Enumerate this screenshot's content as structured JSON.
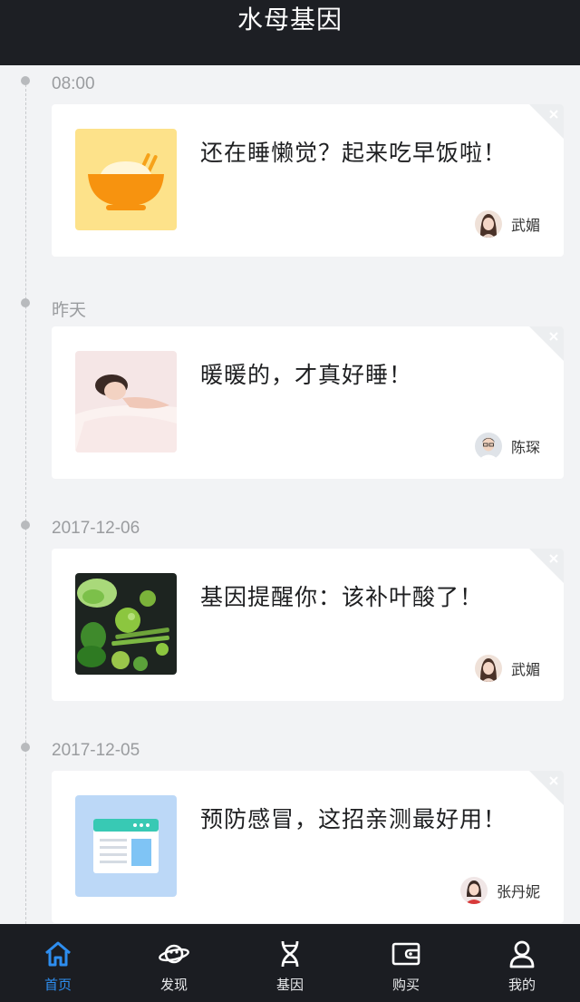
{
  "header": {
    "title": "水母基因"
  },
  "entries": [
    {
      "date": "08:00",
      "text": "还在睡懒觉？起来吃早饭啦！",
      "author": "武媚",
      "thumb": "breakfast-bowl-image"
    },
    {
      "date": "昨天",
      "text": "暖暖的，才真好睡！",
      "author": "陈琛",
      "thumb": "sleeping-woman-photo"
    },
    {
      "date": "2017-12-06",
      "text": "基因提醒你：该补叶酸了！",
      "author": "武媚",
      "thumb": "green-vegetables-photo"
    },
    {
      "date": "2017-12-05",
      "text": "预防感冒，这招亲测最好用！",
      "author": "张丹妮",
      "thumb": "browser-window-image"
    }
  ],
  "nav": {
    "items": [
      {
        "label": "首页",
        "icon": "home-icon",
        "active": true
      },
      {
        "label": "发现",
        "icon": "planet-icon"
      },
      {
        "label": "基因",
        "icon": "dna-icon"
      },
      {
        "label": "购买",
        "icon": "wallet-icon"
      },
      {
        "label": "我的",
        "icon": "user-icon"
      }
    ]
  },
  "colors": {
    "header_bg": "#1d1f24",
    "nav_bg": "#1b1d22",
    "accent": "#2e8ef0",
    "page_bg": "#f2f3f5"
  }
}
